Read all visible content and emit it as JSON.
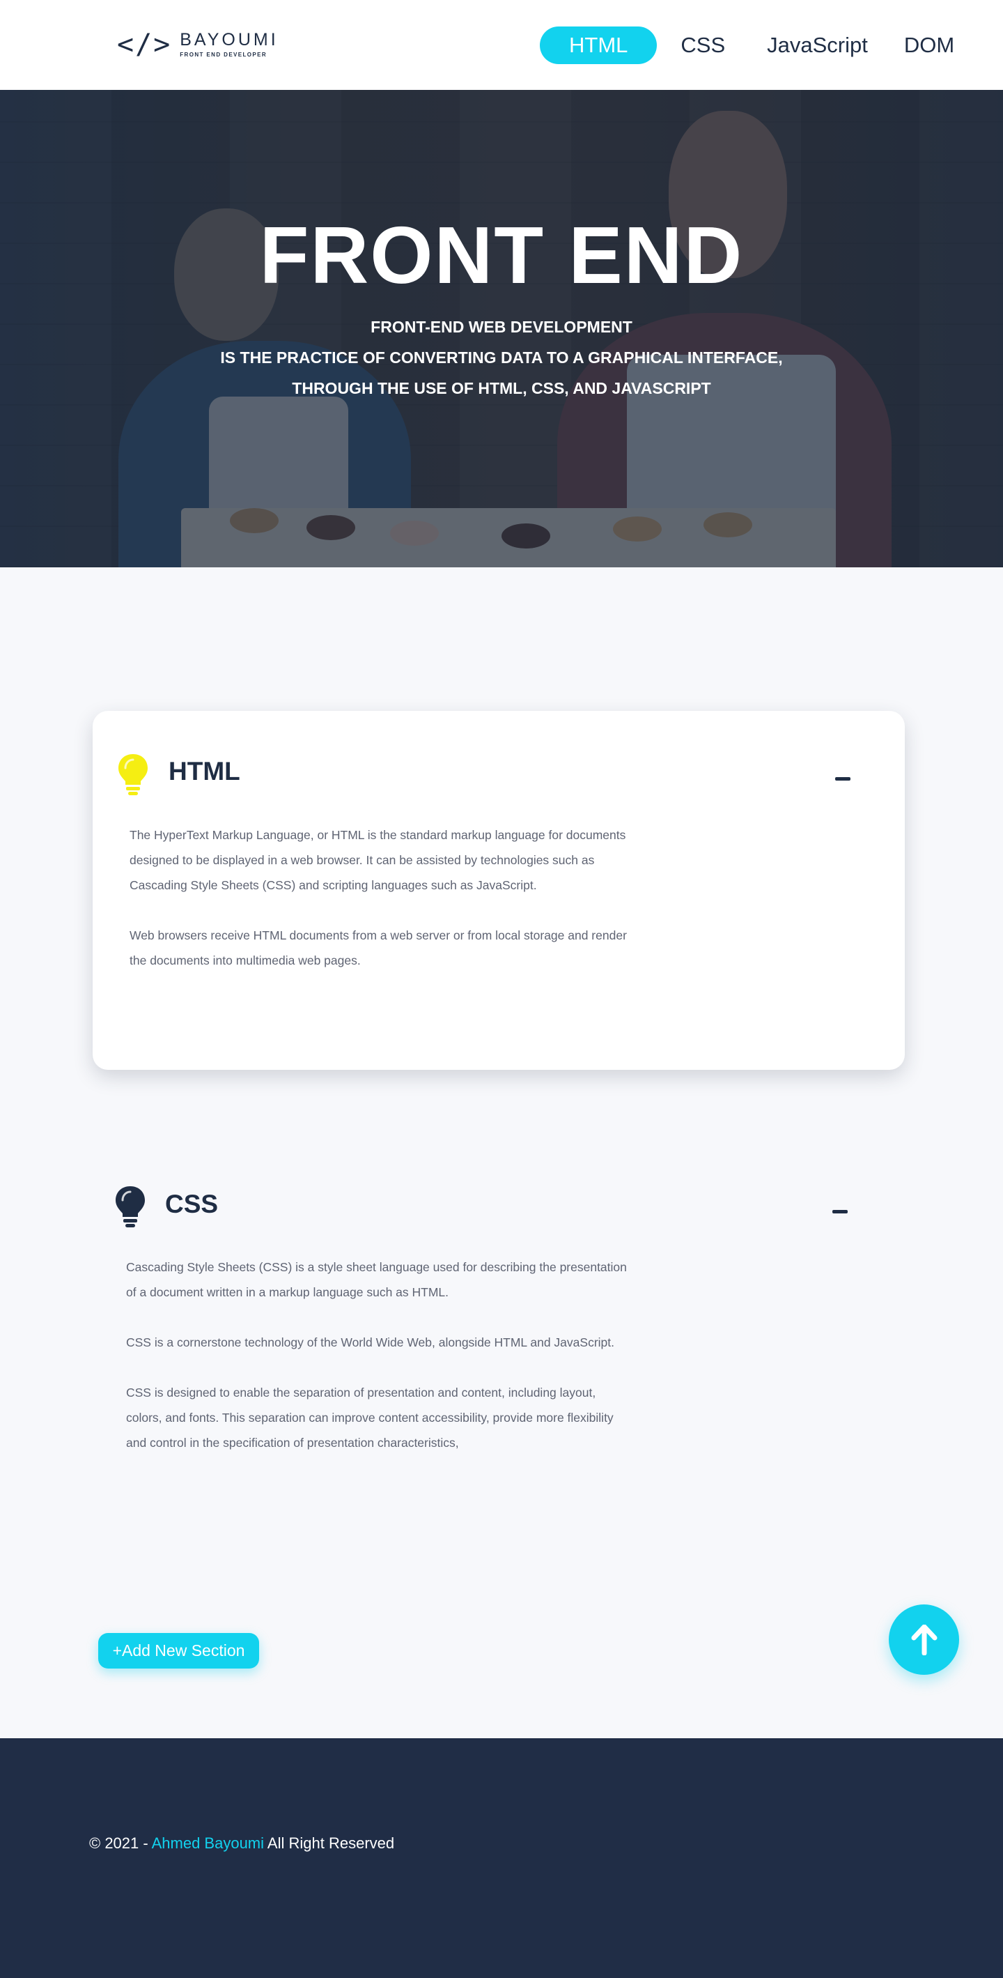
{
  "header": {
    "logo": {
      "mark": "</>",
      "name": "BAYOUMI",
      "subtitle": "FRONT END DEVELOPER"
    },
    "nav": [
      {
        "label": "HTML",
        "active": true
      },
      {
        "label": "CSS",
        "active": false
      },
      {
        "label": "JavaScript",
        "active": false
      },
      {
        "label": "DOM",
        "active": false
      }
    ]
  },
  "hero": {
    "title": "FRONT END",
    "subtitle_lines": [
      "FRONT-END WEB DEVELOPMENT",
      "IS THE PRACTICE OF CONVERTING DATA TO A GRAPHICAL INTERFACE,",
      "THROUGH THE USE OF HTML, CSS, AND JAVASCRIPT"
    ]
  },
  "sections": [
    {
      "title": "HTML",
      "icon": "lightbulb-icon",
      "icon_color": "#f5ee12",
      "active": true,
      "paragraphs": [
        "The HyperText Markup Language, or HTML is the standard markup language for documents designed to be displayed in a web browser. It can be assisted by technologies such as Cascading Style Sheets (CSS) and scripting languages such as JavaScript.",
        "Web browsers receive HTML documents from a web server or from local storage and render the documents into multimedia web pages."
      ]
    },
    {
      "title": "CSS",
      "icon": "lightbulb-icon",
      "icon_color": "#1f2d44",
      "active": false,
      "paragraphs": [
        "Cascading Style Sheets (CSS) is a style sheet language used for describing the presentation of a document written in a markup language such as HTML.",
        "CSS is a cornerstone technology of the World Wide Web, alongside HTML and JavaScript.",
        "CSS is designed to enable the separation of presentation and content, including layout, colors, and fonts. This separation can improve content accessibility, provide more flexibility and control in the specification of presentation characteristics,"
      ]
    }
  ],
  "actions": {
    "add_section_label": "+Add New Section",
    "scroll_top_icon": "arrow-up-icon"
  },
  "footer": {
    "prefix": "© 2021 - ",
    "author": "Ahmed Bayoumi",
    "suffix": " All Right Reserved"
  },
  "colors": {
    "accent": "#12d2ee",
    "dark": "#1f2d44",
    "footer_bg": "#202d46",
    "page_bg": "#f7f8fb"
  }
}
